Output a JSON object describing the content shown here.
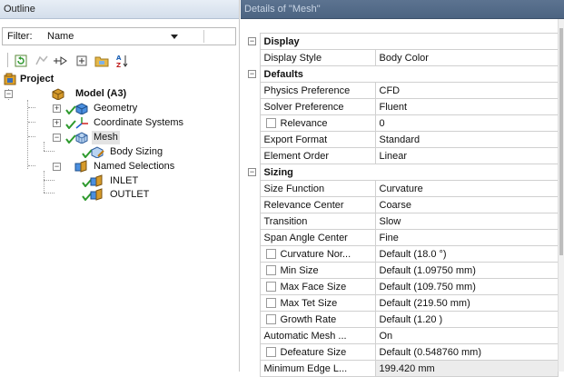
{
  "outline": {
    "title": "Outline",
    "filter": {
      "label": "Filter:",
      "value": "Name"
    },
    "tree": {
      "project": "Project",
      "model": "Model (A3)",
      "geometry": "Geometry",
      "coordinate_systems": "Coordinate Systems",
      "mesh": "Mesh",
      "body_sizing": "Body Sizing",
      "named_selections": "Named Selections",
      "inlet": "INLET",
      "outlet": "OUTLET"
    }
  },
  "details": {
    "title": "Details of \"Mesh\"",
    "rows": [
      {
        "type": "cat",
        "name": "Display"
      },
      {
        "type": "prop",
        "name": "Display Style",
        "value": "Body Color"
      },
      {
        "type": "cat",
        "name": "Defaults"
      },
      {
        "type": "prop",
        "name": "Physics Preference",
        "value": "CFD"
      },
      {
        "type": "prop",
        "name": "Solver Preference",
        "value": "Fluent"
      },
      {
        "type": "prop",
        "name": "Relevance",
        "value": "0",
        "checkbox": true
      },
      {
        "type": "prop",
        "name": "Export Format",
        "value": "Standard"
      },
      {
        "type": "prop",
        "name": "Element Order",
        "value": "Linear"
      },
      {
        "type": "cat",
        "name": "Sizing"
      },
      {
        "type": "prop",
        "name": "Size Function",
        "value": "Curvature"
      },
      {
        "type": "prop",
        "name": "Relevance Center",
        "value": "Coarse"
      },
      {
        "type": "prop",
        "name": "Transition",
        "value": "Slow"
      },
      {
        "type": "prop",
        "name": "Span Angle Center",
        "value": "Fine"
      },
      {
        "type": "prop",
        "name": "Curvature Nor...",
        "value": "Default (18.0 °)",
        "checkbox": true
      },
      {
        "type": "prop",
        "name": "Min Size",
        "value": "Default (1.09750 mm)",
        "checkbox": true
      },
      {
        "type": "prop",
        "name": "Max Face Size",
        "value": "Default (109.750 mm)",
        "checkbox": true
      },
      {
        "type": "prop",
        "name": "Max Tet Size",
        "value": "Default (219.50 mm)",
        "checkbox": true
      },
      {
        "type": "prop",
        "name": "Growth Rate",
        "value": "Default (1.20 )",
        "checkbox": true
      },
      {
        "type": "prop",
        "name": "Automatic Mesh ...",
        "value": "On"
      },
      {
        "type": "prop",
        "name": "Defeature Size",
        "value": "Default (0.548760 mm)",
        "checkbox": true
      },
      {
        "type": "prop",
        "name": "Minimum Edge L...",
        "value": "199.420 mm",
        "readonly": true
      }
    ]
  },
  "colors": {
    "check_green": "#2e9a2e",
    "model_orange": "#d69a2a",
    "mesh_blue": "#3b7fd0",
    "readonly_bg": "#ececec"
  }
}
